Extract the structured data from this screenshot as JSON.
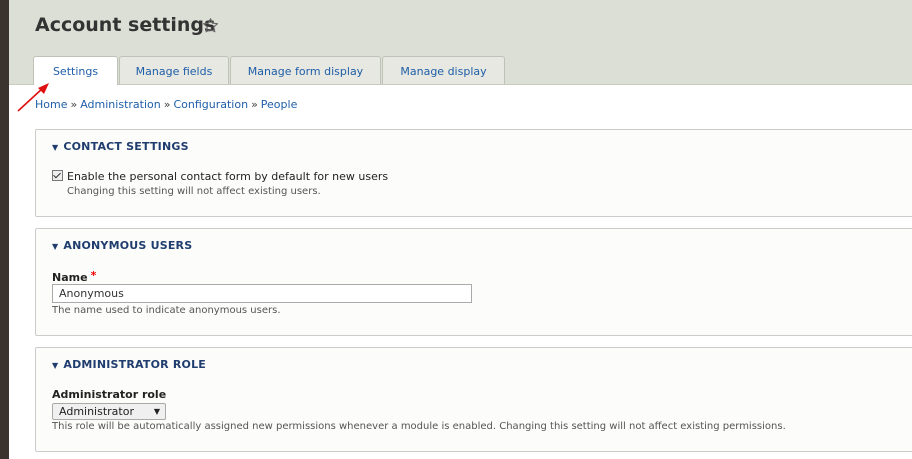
{
  "header": {
    "title": "Account settings"
  },
  "tabs": [
    {
      "label": "Settings",
      "active": true
    },
    {
      "label": "Manage fields",
      "active": false
    },
    {
      "label": "Manage form display",
      "active": false
    },
    {
      "label": "Manage display",
      "active": false
    }
  ],
  "breadcrumb": [
    "Home",
    "Administration",
    "Configuration",
    "People"
  ],
  "breadcrumb_separator": "»",
  "sections": {
    "contact": {
      "legend": "CONTACT SETTINGS",
      "checkbox_label": "Enable the personal contact form by default for new users",
      "checkbox_checked": true,
      "description": "Changing this setting will not affect existing users."
    },
    "anonymous": {
      "legend": "ANONYMOUS USERS",
      "field_label": "Name",
      "required_mark": "*",
      "value": "Anonymous",
      "description": "The name used to indicate anonymous users."
    },
    "admin": {
      "legend": "ADMINISTRATOR ROLE",
      "field_label": "Administrator role",
      "selected": "Administrator",
      "description": "This role will be automatically assigned new permissions whenever a module is enabled. Changing this setting will not affect existing permissions."
    }
  },
  "icons": {
    "favorite": "star-outline-icon",
    "collapse": "triangle-down-icon",
    "annotation": "red-arrow-icon"
  },
  "colors": {
    "link": "#1f5ea8",
    "legend": "#1f3d6e",
    "header_bg": "#dcdfd5",
    "arrow": "#e01010"
  }
}
